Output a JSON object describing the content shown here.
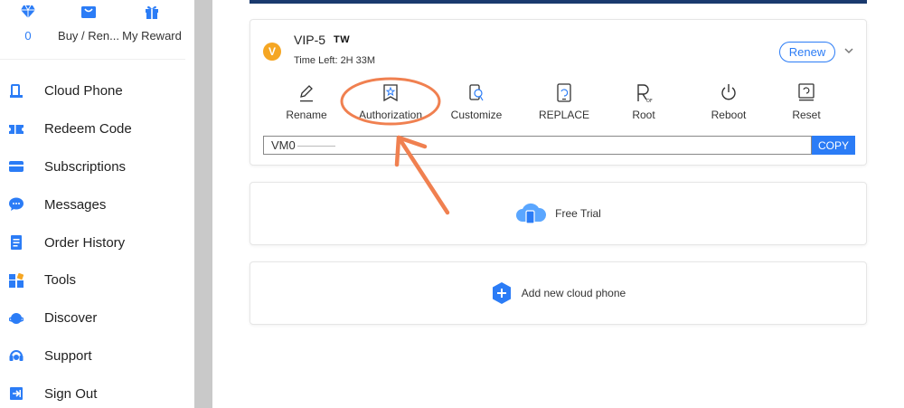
{
  "top_stats": {
    "diamonds": "0",
    "buy_renew": "Buy / Ren...",
    "my_reward": "My Reward"
  },
  "menu": [
    {
      "label": "Cloud Phone",
      "icon": "phone-icon"
    },
    {
      "label": "Redeem Code",
      "icon": "ticket-icon"
    },
    {
      "label": "Subscriptions",
      "icon": "card-icon"
    },
    {
      "label": "Messages",
      "icon": "chat-icon"
    },
    {
      "label": "Order History",
      "icon": "document-icon"
    },
    {
      "label": "Tools",
      "icon": "grid-icon"
    },
    {
      "label": "Discover",
      "icon": "planet-icon"
    },
    {
      "label": "Support",
      "icon": "headset-icon"
    },
    {
      "label": "Sign Out",
      "icon": "logout-icon"
    }
  ],
  "device": {
    "badge": "V",
    "name": "VIP-5",
    "region": "TW",
    "time_left_label": "Time Left:",
    "time_left_value": "2H  33M",
    "renew_label": "Renew",
    "actions": [
      {
        "label": "Rename",
        "icon": "pencil-icon"
      },
      {
        "label": "Authorization",
        "icon": "authorization-icon"
      },
      {
        "label": "Customize",
        "icon": "customize-icon"
      },
      {
        "label": "REPLACE",
        "icon": "replace-icon"
      },
      {
        "label": "Root",
        "icon": "root-icon"
      },
      {
        "label": "Reboot",
        "icon": "power-icon"
      },
      {
        "label": "Reset",
        "icon": "reset-icon"
      }
    ],
    "vm_id": "VM0",
    "copy_label": "COPY"
  },
  "free_trial": {
    "label": "Free Trial",
    "icon": "cloud-phone-icon"
  },
  "add_phone": {
    "label": "Add new cloud phone",
    "icon": "plus-hexagon-icon"
  },
  "colors": {
    "accent": "#2b7cf6",
    "annotation": "#f08050",
    "badge": "#f5a623"
  }
}
